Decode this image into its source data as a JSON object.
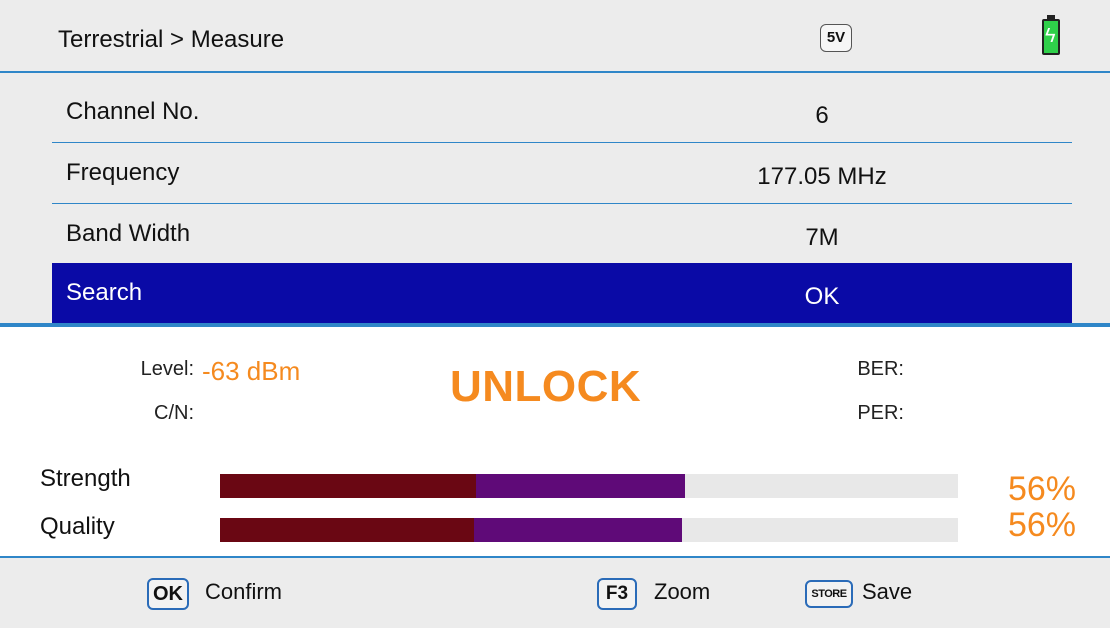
{
  "header": {
    "title": "Terrestrial > Measure",
    "voltage_badge": "5V",
    "battery_icon": "battery-charging-icon"
  },
  "menu": [
    {
      "label": "Channel No.",
      "value": "6"
    },
    {
      "label": "Frequency",
      "value": "177.05 MHz"
    },
    {
      "label": "Band Width",
      "value": "7M"
    },
    {
      "label": "Search",
      "value": "OK",
      "selected": true
    }
  ],
  "measure": {
    "level_label": "Level:",
    "level_value": "-63 dBm",
    "cn_label": "C/N:",
    "status": "UNLOCK",
    "ber_label": "BER:",
    "per_label": "PER:"
  },
  "bars": {
    "strength": {
      "label": "Strength",
      "percent_text": "56%",
      "fraction": 0.63
    },
    "quality": {
      "label": "Quality",
      "percent_text": "56%",
      "fraction": 0.626
    }
  },
  "footer": {
    "ok_key": "OK",
    "confirm": "Confirm",
    "f3_key": "F3",
    "zoom": "Zoom",
    "store_key": "STORE",
    "save": "Save"
  },
  "colors": {
    "accent": "#2f86c8",
    "selected_bg": "#0a0aa6",
    "value_orange": "#f58a1f",
    "bar_dark": "#6a0713",
    "bar_purple": "#5f0a78"
  }
}
